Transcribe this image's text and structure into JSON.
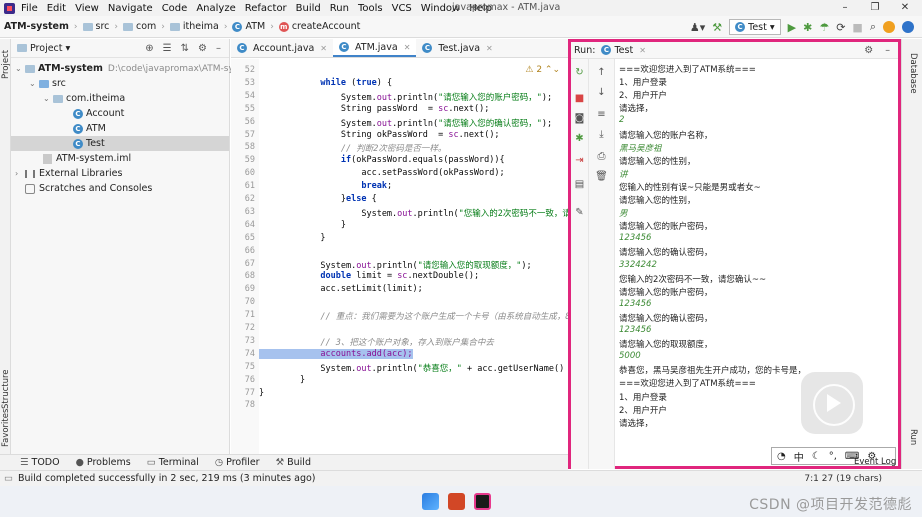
{
  "window": {
    "title": "javapromax - ATM.java",
    "menu": [
      "File",
      "Edit",
      "View",
      "Navigate",
      "Code",
      "Analyze",
      "Refactor",
      "Build",
      "Run",
      "Tools",
      "VCS",
      "Window",
      "Help"
    ]
  },
  "navbar": {
    "crumbs": [
      "ATM-system",
      "src",
      "com",
      "itheima",
      "ATM",
      "createAccount"
    ],
    "run_config": "Test"
  },
  "project": {
    "header": "Project",
    "root": "ATM-system",
    "root_path": "D:\\code\\javapromax\\ATM-system",
    "src": "src",
    "package": "com.itheima",
    "classes": [
      "Account",
      "ATM",
      "Test"
    ],
    "iml": "ATM-system.iml",
    "external": "External Libraries",
    "scratches": "Scratches and Consoles"
  },
  "editor": {
    "tabs": [
      "Account.java",
      "ATM.java",
      "Test.java"
    ],
    "warning_count": "2",
    "line_numbers": [
      "52",
      "53",
      "54",
      "55",
      "56",
      "57",
      "58",
      "59",
      "60",
      "61",
      "62",
      "63",
      "64",
      "65",
      "66",
      "67",
      "68",
      "69",
      "70",
      "71",
      "72",
      "73",
      "74",
      "75",
      "76",
      "77",
      "78"
    ]
  },
  "run": {
    "label": "Run:",
    "tab": "Test",
    "console": [
      {
        "t": "===欢迎您进入到了ATM系统===",
        "input": false
      },
      {
        "t": "1、用户登录",
        "input": false
      },
      {
        "t": "2、用户开户",
        "input": false
      },
      {
        "t": "请选择，",
        "input": false
      },
      {
        "t": "2",
        "input": true
      },
      {
        "t": "请您输入您的账户名称，",
        "input": false
      },
      {
        "t": "黑马吴彦祖",
        "input": true
      },
      {
        "t": "请您输入您的性别，",
        "input": false
      },
      {
        "t": "讲",
        "input": true
      },
      {
        "t": "您输入的性别有误~只能是男或者女~",
        "input": false
      },
      {
        "t": "请您输入您的性别，",
        "input": false
      },
      {
        "t": "男",
        "input": true
      },
      {
        "t": "请您输入您的账户密码，",
        "input": false
      },
      {
        "t": "123456",
        "input": true
      },
      {
        "t": "请您输入您的确认密码，",
        "input": false
      },
      {
        "t": "3324242",
        "input": true
      },
      {
        "t": "您输入的2次密码不一致，请您确认~~",
        "input": false
      },
      {
        "t": "请您输入您的账户密码，",
        "input": false
      },
      {
        "t": "123456",
        "input": true
      },
      {
        "t": "请您输入您的确认密码，",
        "input": false
      },
      {
        "t": "123456",
        "input": true
      },
      {
        "t": "请您输入您的取现额度，",
        "input": false
      },
      {
        "t": "5000",
        "input": true
      },
      {
        "t": "恭喜您，黑马吴彦祖先生开户成功，您的卡号是，",
        "input": false
      },
      {
        "t": "===欢迎您进入到了ATM系统===",
        "input": false
      },
      {
        "t": "1、用户登录",
        "input": false
      },
      {
        "t": "2、用户开户",
        "input": false
      },
      {
        "t": "请选择，",
        "input": false
      }
    ]
  },
  "ime": {
    "mode": "中"
  },
  "sidebars": {
    "left": [
      "Project",
      "Structure",
      "Favorites"
    ],
    "right": [
      "Database",
      "Run"
    ]
  },
  "bottom_tools": [
    "TODO",
    "Problems",
    "Terminal",
    "Profiler",
    "Build"
  ],
  "status": {
    "message": "Build completed successfully in 2 sec, 219 ms (3 minutes ago)",
    "caret": "7:1",
    "caret_extra": "27 (19 chars)",
    "event_log": "Event Log"
  },
  "watermark": "CSDN @项目开发范德彪",
  "colors": {
    "highlight_border": "#e0267d",
    "input_text": "#3c8a34"
  }
}
